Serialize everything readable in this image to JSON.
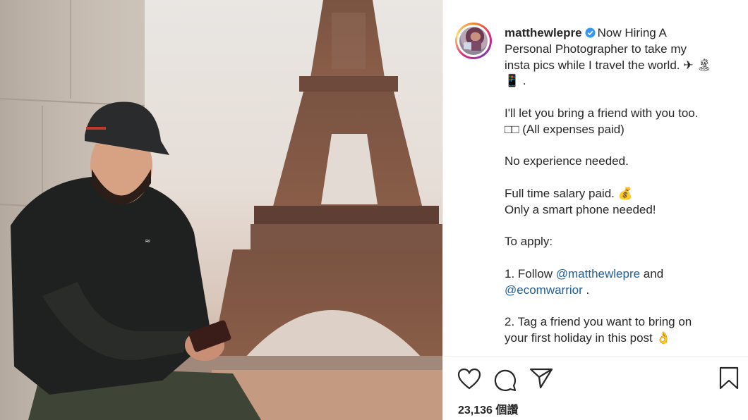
{
  "post": {
    "username": "matthewlepre",
    "caption_lines": [
      [
        "Now Hiring A",
        "Personal Photographer to take my",
        "insta pics while I travel the world. ✈ 🏝",
        "📱 ."
      ],
      [
        "I'll let you bring a friend with you too.",
        "□□ (All expenses paid)"
      ],
      [
        "No experience needed."
      ],
      [
        "Full time salary paid. 💰",
        "Only a smart phone needed!"
      ],
      [
        "To apply:"
      ]
    ],
    "follow_prefix": "1. Follow ",
    "mention_1": "@matthewlepre",
    "follow_and": " and",
    "mention_2": "@ecomwarrior",
    "follow_end": " .",
    "tag_line_1": "2. Tag a friend you want to bring on",
    "tag_line_2": "your first holiday in this post 👌",
    "likes_text": "23,136 個讚"
  },
  "icons": {
    "like": "heart-icon",
    "comment": "comment-icon",
    "share": "share-icon",
    "save": "bookmark-icon",
    "verified": "verified-badge-icon"
  },
  "colors": {
    "verified_blue": "#3897f0",
    "mention_blue": "#1f5e9a",
    "text": "#262626"
  }
}
